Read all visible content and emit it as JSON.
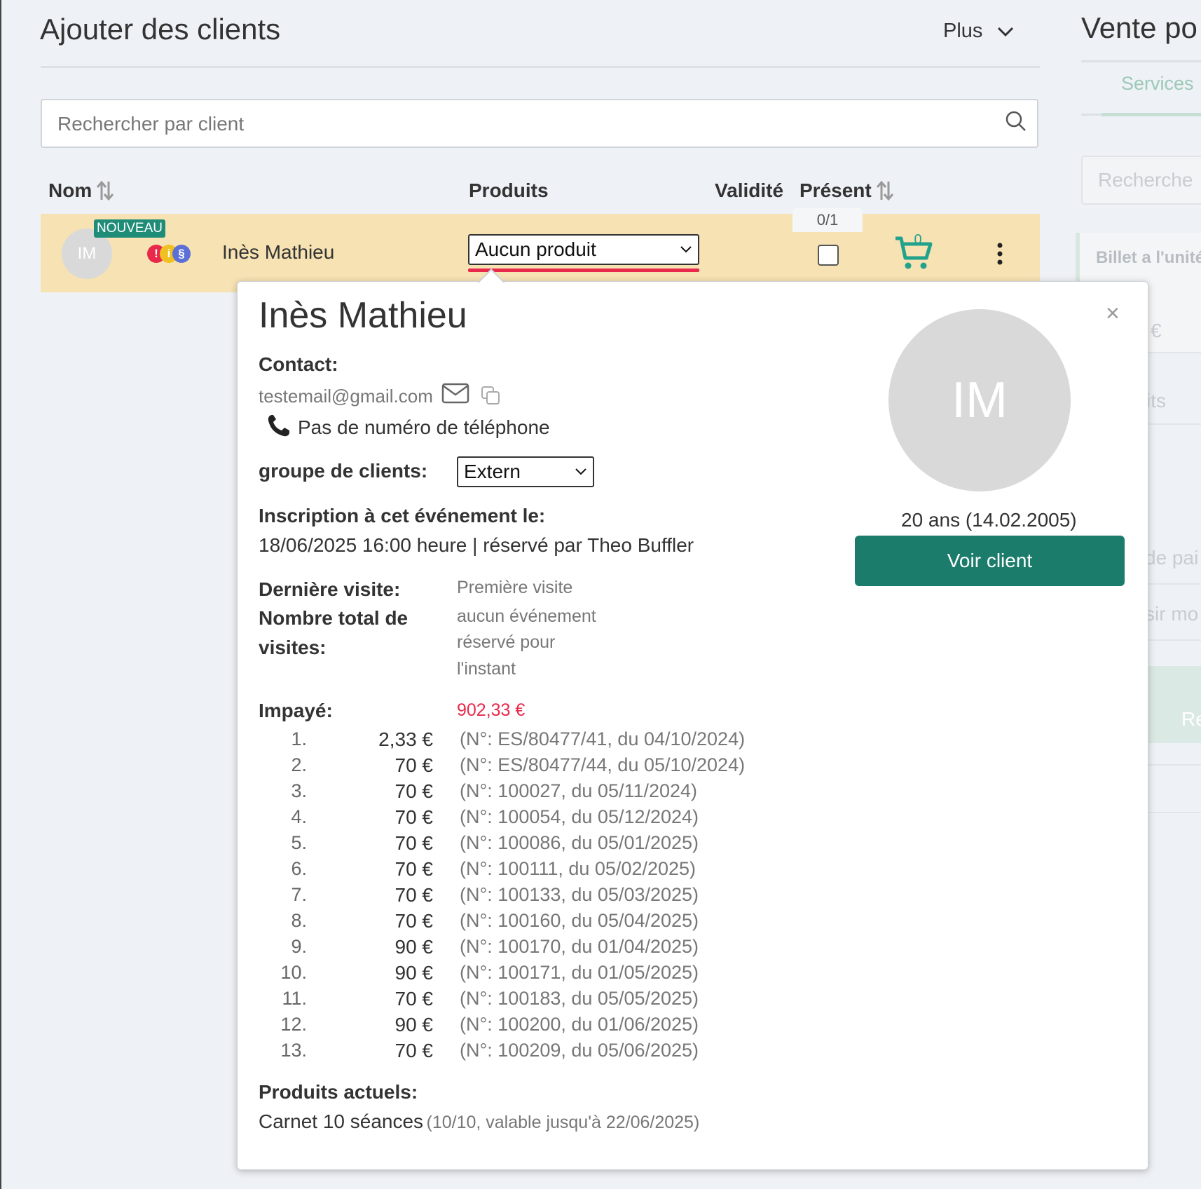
{
  "header": {
    "title": "Ajouter des clients",
    "more_label": "Plus"
  },
  "search": {
    "placeholder": "Rechercher par client"
  },
  "table": {
    "columns": {
      "name": "Nom",
      "products": "Produits",
      "validity": "Validité",
      "present": "Présent"
    },
    "row": {
      "badge": "NOUVEAU",
      "initials": "IM",
      "name": "Inès Mathieu",
      "product_selected": "Aucun produit",
      "presence_count": "0/1",
      "cart_count": "0",
      "flags": [
        "!",
        "i",
        "§"
      ]
    }
  },
  "right_panel": {
    "title": "Vente po",
    "tab": "Services",
    "search_placeholder": "Recherche",
    "card_title": "Billet a l'unité",
    "faded_1": "€",
    "faded_2": "its",
    "faded_3": "de pai",
    "faded_4": "sir mo",
    "faded_5": "Re"
  },
  "popover": {
    "name": "Inès Mathieu",
    "initials": "IM",
    "contact_label": "Contact:",
    "email": "testemail@gmail.com",
    "phone": "Pas de numéro de téléphone",
    "group_label": "groupe de clients:",
    "group_value": "Extern",
    "registration_label": "Inscription à cet événement le:",
    "registration_value": "18/06/2025 16:00 heure | réservé par Theo Buffler",
    "last_visit_label": "Dernière visite:",
    "last_visit_value": "Première visite",
    "total_visits_label_1": "Nombre total de",
    "total_visits_label_2": "visites:",
    "total_visits_value_1": "aucun événement",
    "total_visits_value_2": "réservé pour",
    "total_visits_value_3": "l'instant",
    "unpaid_label": "Impayé:",
    "unpaid_total": "902,33 €",
    "unpaid_items": [
      {
        "num": "1.",
        "amount": "2,33 €",
        "ref": "(N°: ES/80477/41, du 04/10/2024)"
      },
      {
        "num": "2.",
        "amount": "70 €",
        "ref": "(N°: ES/80477/44, du 05/10/2024)"
      },
      {
        "num": "3.",
        "amount": "70 €",
        "ref": "(N°: 100027, du 05/11/2024)"
      },
      {
        "num": "4.",
        "amount": "70 €",
        "ref": "(N°: 100054, du 05/12/2024)"
      },
      {
        "num": "5.",
        "amount": "70 €",
        "ref": "(N°: 100086, du 05/01/2025)"
      },
      {
        "num": "6.",
        "amount": "70 €",
        "ref": "(N°: 100111, du 05/02/2025)"
      },
      {
        "num": "7.",
        "amount": "70 €",
        "ref": "(N°: 100133, du 05/03/2025)"
      },
      {
        "num": "8.",
        "amount": "70 €",
        "ref": "(N°: 100160, du 05/04/2025)"
      },
      {
        "num": "9.",
        "amount": "90 €",
        "ref": "(N°: 100170, du 01/04/2025)"
      },
      {
        "num": "10.",
        "amount": "90 €",
        "ref": "(N°: 100171, du 01/05/2025)"
      },
      {
        "num": "11.",
        "amount": "70 €",
        "ref": "(N°: 100183, du 05/05/2025)"
      },
      {
        "num": "12.",
        "amount": "90 €",
        "ref": "(N°: 100200, du 01/06/2025)"
      },
      {
        "num": "13.",
        "amount": "70 €",
        "ref": "(N°: 100209, du 05/06/2025)"
      }
    ],
    "current_products_label": "Produits actuels:",
    "current_product_name": "Carnet 10 séances",
    "current_product_detail": "(10/10, valable jusqu'à 22/06/2025)",
    "age": "20 ans (14.02.2005)",
    "view_client_label": "Voir client",
    "close_symbol": "×"
  },
  "colors": {
    "accent": "#1c7c6b",
    "new_badge": "#1f8c78",
    "row_highlight": "#f6e2b3",
    "alert_red": "#e9294b",
    "cart": "#22a28c"
  }
}
